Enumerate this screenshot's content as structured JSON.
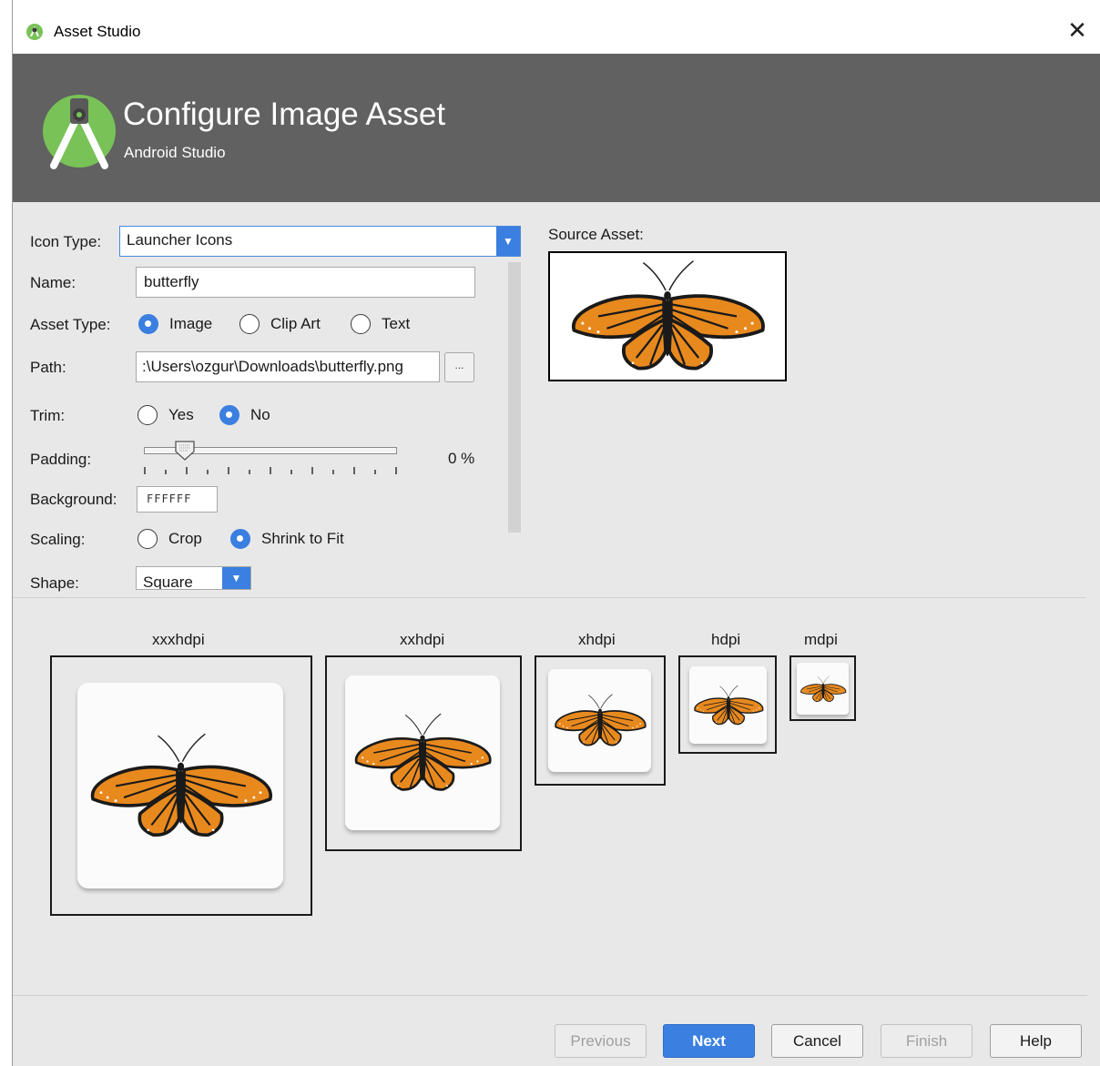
{
  "window": {
    "title": "Asset Studio",
    "close_glyph": "✕"
  },
  "header": {
    "title": "Configure Image Asset",
    "subtitle": "Android Studio"
  },
  "form": {
    "icon_type": {
      "label": "Icon Type:",
      "value": "Launcher Icons"
    },
    "name": {
      "label": "Name:",
      "value": "butterfly"
    },
    "asset_type": {
      "label": "Asset Type:",
      "options": [
        "Image",
        "Clip Art",
        "Text"
      ],
      "selected": "Image"
    },
    "path": {
      "label": "Path:",
      "value": ":\\Users\\ozgur\\Downloads\\butterfly.png",
      "browse_label": "..."
    },
    "trim": {
      "label": "Trim:",
      "options": [
        "Yes",
        "No"
      ],
      "selected": "No"
    },
    "padding": {
      "label": "Padding:",
      "value": "0 %",
      "level": 0.15
    },
    "background": {
      "label": "Background:",
      "value": "FFFFFF"
    },
    "scaling": {
      "label": "Scaling:",
      "options": [
        "Crop",
        "Shrink to Fit"
      ],
      "selected": "Shrink to Fit"
    },
    "shape": {
      "label": "Shape:",
      "value": "Square"
    }
  },
  "source": {
    "label": "Source Asset:"
  },
  "densities": [
    "xxxhdpi",
    "xxhdpi",
    "xhdpi",
    "hdpi",
    "mdpi"
  ],
  "buttons": {
    "previous": "Previous",
    "next": "Next",
    "cancel": "Cancel",
    "finish": "Finish",
    "help": "Help"
  },
  "colors": {
    "accent": "#3b7fe0",
    "header_bg": "#616161",
    "android_green": "#78c257",
    "butterfly_orange": "#e8891e"
  }
}
